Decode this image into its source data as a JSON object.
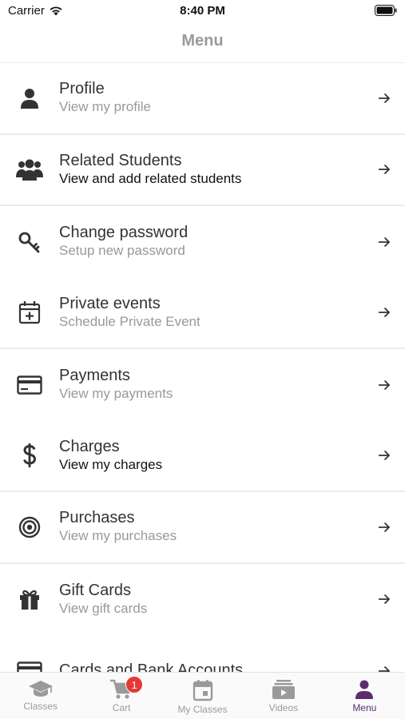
{
  "status_bar": {
    "carrier": "Carrier",
    "time": "8:40 PM"
  },
  "nav": {
    "title": "Menu"
  },
  "menu": {
    "items": [
      {
        "title": "Profile",
        "subtitle": "View my profile",
        "icon": "person-icon"
      },
      {
        "title": "Related Students",
        "subtitle": "View and add related students",
        "icon": "group-icon"
      },
      {
        "title": "Change password",
        "subtitle": "Setup new password",
        "icon": "key-icon"
      },
      {
        "title": "Private events",
        "subtitle": "Schedule Private Event",
        "icon": "calendar-plus-icon"
      },
      {
        "title": "Payments",
        "subtitle": "View my payments",
        "icon": "credit-card-icon"
      },
      {
        "title": "Charges",
        "subtitle": "View my charges",
        "icon": "dollar-icon"
      },
      {
        "title": "Purchases",
        "subtitle": "View my purchases",
        "icon": "target-icon"
      },
      {
        "title": "Gift Cards",
        "subtitle": "View gift cards",
        "icon": "gift-icon"
      },
      {
        "title": "Cards and Bank Accounts",
        "subtitle": "",
        "icon": "credit-card-icon"
      }
    ]
  },
  "tabbar": {
    "tabs": [
      {
        "label": "Classes",
        "icon": "graduation-cap-icon"
      },
      {
        "label": "Cart",
        "icon": "cart-icon",
        "badge": "1"
      },
      {
        "label": "My Classes",
        "icon": "calendar-icon"
      },
      {
        "label": "Videos",
        "icon": "video-library-icon"
      },
      {
        "label": "Menu",
        "icon": "person-icon",
        "active": true
      }
    ]
  },
  "colors": {
    "accent": "#5b2d6e",
    "badge": "#e53935",
    "inactive": "#9a9a9a"
  }
}
